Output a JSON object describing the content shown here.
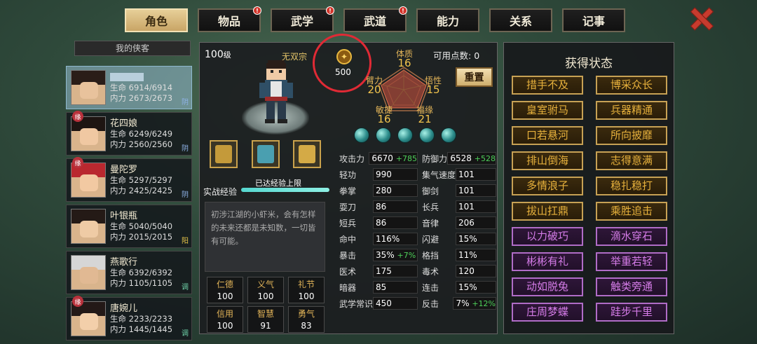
{
  "tabs": [
    {
      "label": "角色",
      "active": true,
      "alert": false
    },
    {
      "label": "物品",
      "active": false,
      "alert": true
    },
    {
      "label": "武学",
      "active": false,
      "alert": true
    },
    {
      "label": "武道",
      "active": false,
      "alert": true
    },
    {
      "label": "能力",
      "active": false,
      "alert": false
    },
    {
      "label": "关系",
      "active": false,
      "alert": false
    },
    {
      "label": "记事",
      "active": false,
      "alert": false
    }
  ],
  "heroes_title": "我的侠客",
  "heroes": [
    {
      "name": "",
      "hp_label": "生命",
      "hp": "6914/6914",
      "mp_label": "内力",
      "mp": "2673/2673",
      "element": "阴",
      "badge": "",
      "selected": true,
      "hair": "#2a1d18",
      "skin": "#e8c29c"
    },
    {
      "name": "花四娘",
      "hp_label": "生命",
      "hp": "6249/6249",
      "mp_label": "内力",
      "mp": "2560/2560",
      "element": "阴",
      "badge": "缘",
      "selected": false,
      "hair": "#1e1512",
      "skin": "#f0c8a2"
    },
    {
      "name": "曼陀罗",
      "hp_label": "生命",
      "hp": "5297/5297",
      "mp_label": "内力",
      "mp": "2425/2425",
      "element": "阴",
      "badge": "缘",
      "selected": false,
      "hair": "#b9282f",
      "skin": "#f2c9a2"
    },
    {
      "name": "叶银瓶",
      "hp_label": "生命",
      "hp": "5040/5040",
      "mp_label": "内力",
      "mp": "2015/2015",
      "element": "阳",
      "badge": "",
      "selected": false,
      "hair": "#241a16",
      "skin": "#efcba5"
    },
    {
      "name": "燕歌行",
      "hp_label": "生命",
      "hp": "6392/6392",
      "mp_label": "内力",
      "mp": "1105/1105",
      "element": "调",
      "badge": "",
      "selected": false,
      "hair": "#d6d6d6",
      "skin": "#e1b993"
    },
    {
      "name": "唐婉儿",
      "hp_label": "生命",
      "hp": "2233/2233",
      "mp_label": "内力",
      "mp": "1445/1445",
      "element": "调",
      "badge": "缘",
      "selected": false,
      "hair": "#231917",
      "skin": "#f3cfaa"
    }
  ],
  "hero_element_colors": {
    "阴": "#8fb3e8",
    "阳": "#e8c64a",
    "调": "#6fd2a8"
  },
  "character": {
    "level": "100",
    "level_unit": "级",
    "sect": "无双宗",
    "rank_value": "500",
    "points_label": "可用点数:",
    "points": "0",
    "reset_label": "重置",
    "attributes": [
      {
        "label": "体质",
        "value": "16"
      },
      {
        "label": "悟性",
        "value": "15"
      },
      {
        "label": "福缘",
        "value": "21"
      },
      {
        "label": "敏捷",
        "value": "16"
      },
      {
        "label": "臂力",
        "value": "20"
      }
    ],
    "exp_label": "实战经验",
    "exp_message": "已达经验上限",
    "exp_fraction": 1.0,
    "description": "初涉江湖的小虾米，会有怎样的未来还都是未知数，一切皆有可能。",
    "equipment": [
      {
        "name": "gauntlet-icon",
        "color": "#c49a3a"
      },
      {
        "name": "armor-icon",
        "color": "#4a9fb0"
      },
      {
        "name": "scroll-icon",
        "color": "#d4aa46"
      }
    ],
    "virtues": [
      {
        "label": "仁德",
        "value": "100"
      },
      {
        "label": "义气",
        "value": "100"
      },
      {
        "label": "礼节",
        "value": "100"
      },
      {
        "label": "信用",
        "value": "100"
      },
      {
        "label": "智慧",
        "value": "91"
      },
      {
        "label": "勇气",
        "value": "83"
      }
    ]
  },
  "stats": [
    {
      "label": "攻击力",
      "value": "6670",
      "bonus": "+785"
    },
    {
      "label": "防御力",
      "value": "6528",
      "bonus": "+528"
    },
    {
      "label": "轻功",
      "value": "990",
      "bonus": ""
    },
    {
      "label": "集气速度",
      "value": "101",
      "bonus": ""
    },
    {
      "label": "拳掌",
      "value": "280",
      "bonus": ""
    },
    {
      "label": "御剑",
      "value": "101",
      "bonus": ""
    },
    {
      "label": "耍刀",
      "value": "86",
      "bonus": ""
    },
    {
      "label": "长兵",
      "value": "101",
      "bonus": ""
    },
    {
      "label": "短兵",
      "value": "86",
      "bonus": ""
    },
    {
      "label": "音律",
      "value": "206",
      "bonus": ""
    },
    {
      "label": "命中",
      "value": "116%",
      "bonus": ""
    },
    {
      "label": "闪避",
      "value": "15%",
      "bonus": ""
    },
    {
      "label": "暴击",
      "value": "35%",
      "bonus": "+7%"
    },
    {
      "label": "格挡",
      "value": "11%",
      "bonus": ""
    },
    {
      "label": "医术",
      "value": "175",
      "bonus": ""
    },
    {
      "label": "毒术",
      "value": "120",
      "bonus": ""
    },
    {
      "label": "暗器",
      "value": "85",
      "bonus": ""
    },
    {
      "label": "连击",
      "value": "15%",
      "bonus": ""
    },
    {
      "label": "武学常识",
      "value": "450",
      "bonus": ""
    },
    {
      "label": "反击",
      "value": "7%",
      "bonus": "+12%"
    }
  ],
  "status_title": "获得状态",
  "statuses": [
    {
      "label": "措手不及",
      "color": "#e7b13c",
      "style": "gold"
    },
    {
      "label": "博采众长",
      "color": "#e7b13c",
      "style": "gold"
    },
    {
      "label": "皇室驸马",
      "color": "#e7b13c",
      "style": "gold"
    },
    {
      "label": "兵器精通",
      "color": "#e7b13c",
      "style": "gold"
    },
    {
      "label": "口若悬河",
      "color": "#e7b13c",
      "style": "gold"
    },
    {
      "label": "所向披靡",
      "color": "#e7b13c",
      "style": "gold"
    },
    {
      "label": "排山倒海",
      "color": "#e7b13c",
      "style": "gold"
    },
    {
      "label": "志得意满",
      "color": "#e7b13c",
      "style": "gold"
    },
    {
      "label": "多情浪子",
      "color": "#e7b13c",
      "style": "gold"
    },
    {
      "label": "稳扎稳打",
      "color": "#e7b13c",
      "style": "gold"
    },
    {
      "label": "拔山扛鼎",
      "color": "#e7b13c",
      "style": "gold"
    },
    {
      "label": "乘胜追击",
      "color": "#e7b13c",
      "style": "gold"
    },
    {
      "label": "以力破巧",
      "color": "#d57ce8",
      "style": "purple"
    },
    {
      "label": "滴水穿石",
      "color": "#d57ce8",
      "style": "purple"
    },
    {
      "label": "彬彬有礼",
      "color": "#d57ce8",
      "style": "purple"
    },
    {
      "label": "举重若轻",
      "color": "#d57ce8",
      "style": "purple"
    },
    {
      "label": "动如脱兔",
      "color": "#d57ce8",
      "style": "purple"
    },
    {
      "label": "触类旁通",
      "color": "#d57ce8",
      "style": "purple"
    },
    {
      "label": "庄周梦蝶",
      "color": "#d57ce8",
      "style": "purple"
    },
    {
      "label": "跬步千里",
      "color": "#d57ce8",
      "style": "purple"
    }
  ]
}
